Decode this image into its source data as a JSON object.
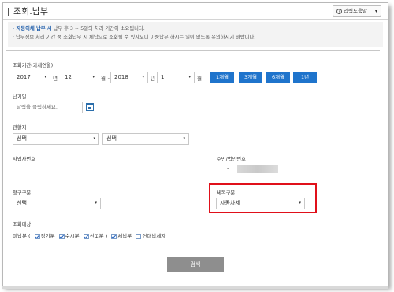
{
  "page": {
    "title": "조회.납부"
  },
  "help_button": {
    "label": "입력도움말",
    "q": "?",
    "caret": "▾"
  },
  "notice": {
    "line1_bold": "· 자동이체 납부 시",
    "line1_rest": " 납부 후 3 ~ 5일의 처리 기간이 소요됩니다.",
    "line2": "· 납부정보 처리 기간 중 조회납부 시 체납으로 조회될 수 있사오니 이중납부 하시는 일이 없도록 유의하시기 바랍니다."
  },
  "period": {
    "label": "조회기간(과세연월)",
    "from_year": "2017",
    "from_month": "12",
    "to_year": "2018",
    "to_month": "1",
    "unit_year": "년",
    "unit_month": "월",
    "tilde": "월 ~",
    "buttons": [
      "1개월",
      "3개월",
      "6개월",
      "1년"
    ]
  },
  "due": {
    "label": "납기일",
    "placeholder": "달력을 클릭하세요."
  },
  "jurisdiction": {
    "label": "관할지",
    "select1": "선택",
    "select2": "선택"
  },
  "business_no": {
    "label": "사업자번호"
  },
  "resident_no": {
    "label": "주민/법인번호",
    "prefix": "-"
  },
  "claim_type": {
    "label": "청구구분",
    "value": "선택"
  },
  "tax_type": {
    "label": "세목구분",
    "value": "자동차세"
  },
  "target": {
    "label": "조회대상",
    "unpaid": "미납분 (",
    "regular": "정기분",
    "occasional": "수시분",
    "report": "신고분",
    "close": " )",
    "overdue": "체납분",
    "annual": "연대납세자",
    "checked": {
      "regular": true,
      "occasional": true,
      "report": true,
      "overdue": true,
      "annual": false
    }
  },
  "search_button": "검색",
  "arrow": "▾"
}
